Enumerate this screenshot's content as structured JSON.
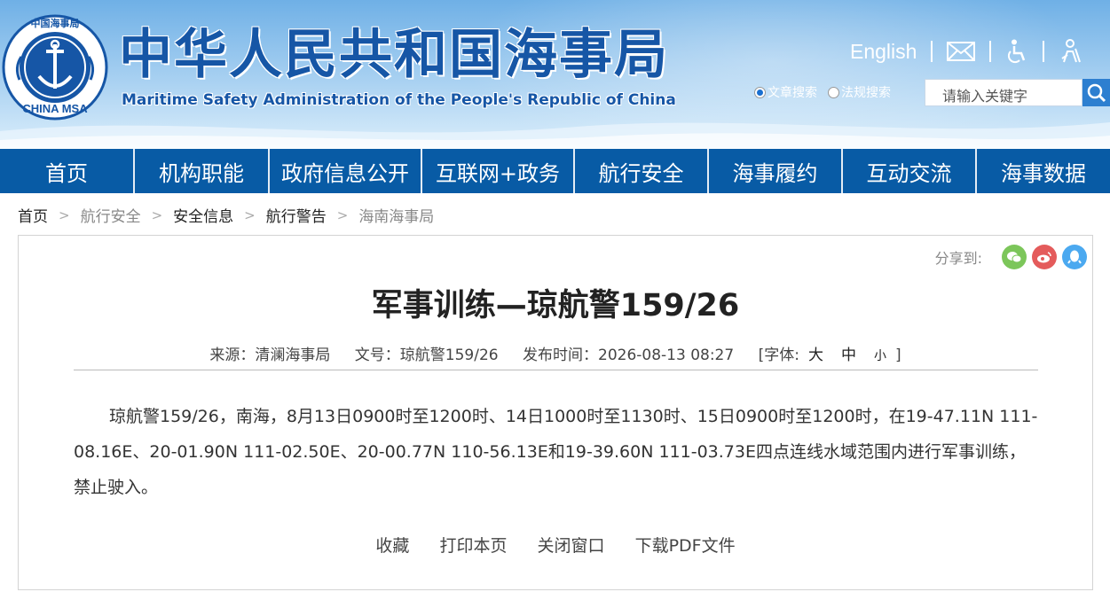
{
  "header": {
    "logo_text": {
      "top": "中国海事局",
      "bottom": "CHINA MSA"
    },
    "title_cn": "中华人民共和国海事局",
    "title_en": "Maritime Safety Administration of the People's Republic of China",
    "lang_link": "English",
    "icons": [
      "mail-icon",
      "accessibility-icon",
      "elder-mode-icon"
    ],
    "search": {
      "options": [
        {
          "label": "文章搜索",
          "selected": true
        },
        {
          "label": "法规搜索",
          "selected": false
        }
      ],
      "placeholder": "请输入关键字"
    }
  },
  "nav": {
    "items": [
      "首页",
      "机构职能",
      "政府信息公开",
      "互联网+政务",
      "航行安全",
      "海事履约",
      "互动交流",
      "海事数据"
    ]
  },
  "breadcrumb": [
    "首页",
    "航行安全",
    "安全信息",
    "航行警告",
    "海南海事局"
  ],
  "article": {
    "share_label": "分享到:",
    "title": "军事训练—琼航警159/26",
    "meta": {
      "source": "来源：清澜海事局",
      "doc_no": "文号：琼航警159/26",
      "published": "发布时间：2026-08-13 08:27",
      "font_label": "[字体:",
      "font_large": "大",
      "font_medium": "中",
      "font_small": "小",
      "font_close": "]"
    },
    "body": "琼航警159/26，南海，8月13日0900时至1200时、14日1000时至1130时、15日0900时至1200时，在19-47.11N 111-08.16E、20-01.90N 111-02.50E、20-00.77N 110-56.13E和19-39.60N 111-03.73E四点连线水域范围内进行军事训练，禁止驶入。",
    "actions": [
      "收藏",
      "打印本页",
      "关闭窗口",
      "下载PDF文件"
    ]
  },
  "colors": {
    "brand_blue": "#085ba5",
    "title_blue": "#1656a6",
    "search_button": "#2d7fd0",
    "wechat": "#7cc65a",
    "weibo": "#e45b5b",
    "qq": "#4ba9f0"
  }
}
